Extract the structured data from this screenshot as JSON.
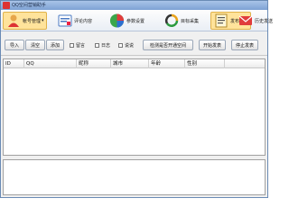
{
  "window": {
    "title": "QQ空间营销助手"
  },
  "toolbar": {
    "items": [
      {
        "label": "帐号管理",
        "icon": "user-account-icon"
      },
      {
        "label": "评论内容",
        "icon": "comment-content-icon"
      },
      {
        "label": "参数设置",
        "icon": "pie-settings-icon"
      },
      {
        "label": "目标采集",
        "icon": "refresh-collect-icon"
      },
      {
        "label": "发布评论",
        "icon": "publish-comment-icon"
      },
      {
        "label": "历史发送",
        "icon": "history-send-icon"
      }
    ]
  },
  "controls": {
    "import_label": "导入",
    "clear_label": "清空",
    "add_label": "添加",
    "check_message_label": "留言",
    "check_diary_label": "日志",
    "check_talk_label": "说说",
    "detect_space_label": "检测是否开通空间",
    "start_send_label": "开始发表",
    "stop_send_label": "停止发表"
  },
  "table": {
    "columns": [
      "ID",
      "QQ",
      "昵称",
      "城市",
      "年龄",
      "性别"
    ]
  },
  "colors": {
    "titlebar": "#7ea2d4",
    "toolbar_active": "#ffe39b",
    "accent_red": "#d33333"
  }
}
